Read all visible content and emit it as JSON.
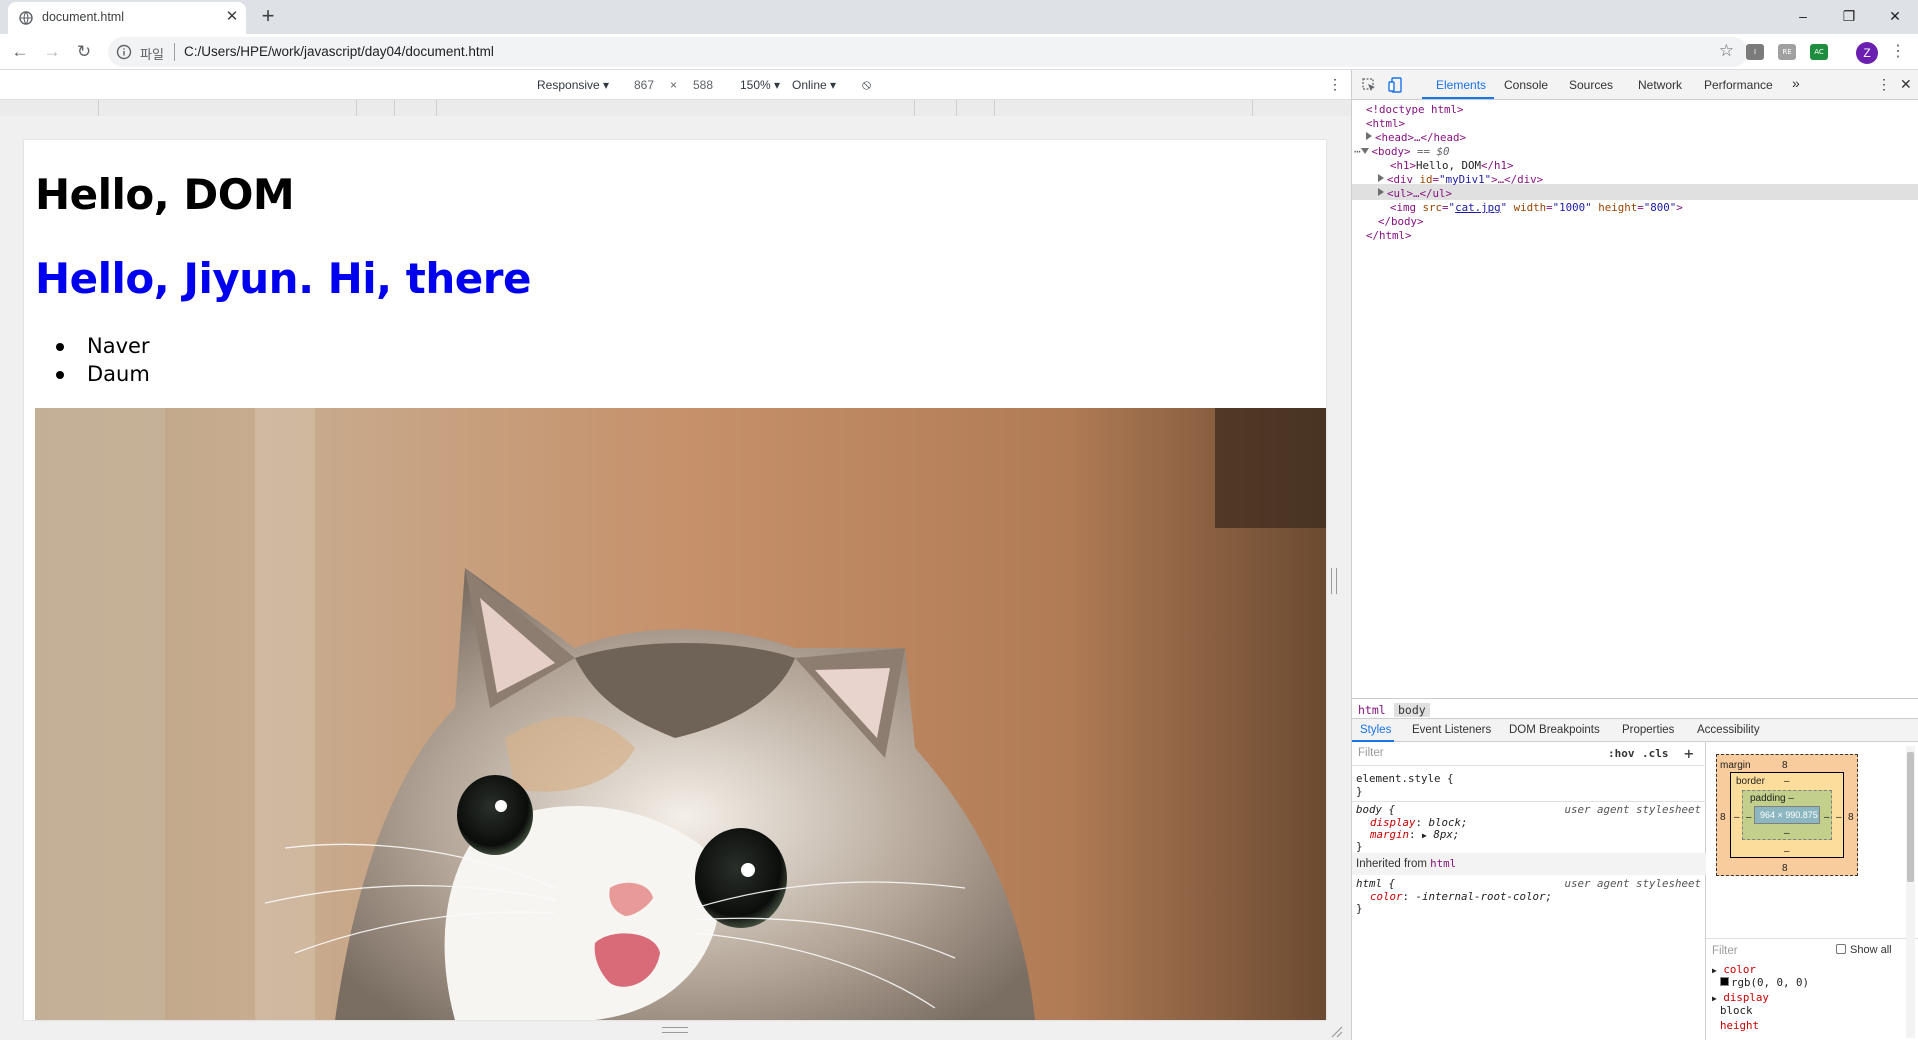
{
  "browser": {
    "tab_title": "document.html",
    "new_tab": "+",
    "scheme_label": "파일",
    "url": "C:/Users/HPE/work/javascript/day04/document.html",
    "avatar_letter": "Z",
    "extensions": [
      "I",
      "RE",
      "AC"
    ]
  },
  "device_toolbar": {
    "device": "Responsive ▾",
    "width": "867",
    "times": "×",
    "height": "588",
    "zoom": "150% ▾",
    "network": "Online ▾"
  },
  "page": {
    "heading1": "Hello, DOM",
    "heading2": "Hello, Jiyun. Hi, there",
    "list_items": [
      "Naver",
      "Daum"
    ]
  },
  "devtools": {
    "tabs": [
      "Elements",
      "Console",
      "Sources",
      "Network",
      "Performance",
      "»"
    ],
    "active_tab": "Elements",
    "dom": {
      "doctype": "<!doctype html>",
      "html_open": "<html>",
      "head": "<head>…</head>",
      "body_open": "<body>",
      "body_eq": " == $0",
      "h1_text": "Hello, DOM",
      "div_id": "myDiv1",
      "ul": "<ul>…</ul>",
      "img_src": "cat.jpg",
      "img_width": "1000",
      "img_height": "800",
      "body_close": "</body>",
      "html_close": "</html>"
    },
    "breadcrumbs": [
      "html",
      "body"
    ],
    "sub_tabs": [
      "Styles",
      "Event Listeners",
      "DOM Breakpoints",
      "Properties",
      "Accessibility"
    ],
    "styles": {
      "filter_placeholder": "Filter",
      "hov": ":hov",
      "cls": ".cls",
      "add": "+",
      "element_style": "element.style {",
      "close_brace": "}",
      "body_selector": "body {",
      "user_agent": "user agent stylesheet",
      "display_prop": "display",
      "display_val": "block;",
      "margin_prop": "margin",
      "margin_val": "8px;",
      "inherited_label": "Inherited from",
      "inherited_tag": "html",
      "html_selector": "html {",
      "color_prop": "color",
      "color_val": "-internal-root-color;"
    },
    "box_model": {
      "margin_label": "margin",
      "margin_top": "8",
      "margin_bottom": "8",
      "margin_left": "8",
      "margin_right": "8",
      "border_label": "border",
      "border_top": "–",
      "border_bottom": "–",
      "border_left": "–",
      "border_right": "–",
      "padding_label": "padding –",
      "padding_bottom": "–",
      "padding_left": "–",
      "padding_right": "–",
      "content": "964 × 990.875"
    },
    "computed": {
      "filter_placeholder": "Filter",
      "show_all": "Show all",
      "props": [
        {
          "name": "color",
          "value": "rgb(0, 0, 0)"
        },
        {
          "name": "display",
          "value": "block"
        },
        {
          "name": "height",
          "value": ""
        }
      ]
    }
  }
}
